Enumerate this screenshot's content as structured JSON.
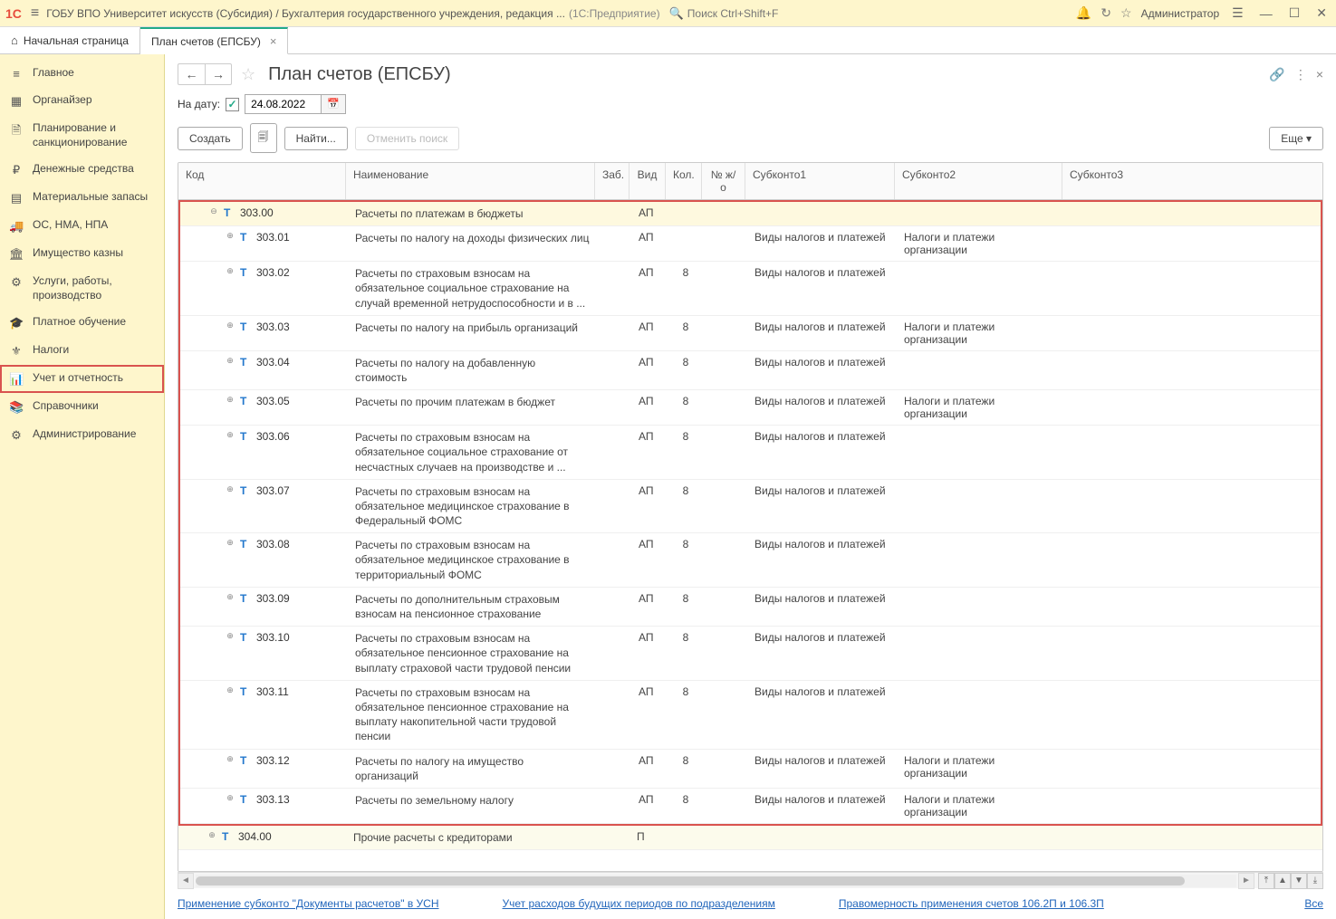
{
  "topbar": {
    "logo_text": "1C",
    "title": "ГОБУ ВПО Университет искусств (Субсидия) / Бухгалтерия государственного учреждения, редакция ...",
    "app_name": "(1С:Предприятие)",
    "search_placeholder": "Поиск Ctrl+Shift+F",
    "user": "Администратор"
  },
  "tabs": {
    "home": "Начальная страница",
    "active": "План счетов (ЕПСБУ)"
  },
  "sidebar": {
    "items": [
      {
        "icon": "≡",
        "label": "Главное"
      },
      {
        "icon": "▦",
        "label": "Органайзер"
      },
      {
        "icon": "🗎",
        "label": "Планирование и санкционирование"
      },
      {
        "icon": "₽",
        "label": "Денежные средства"
      },
      {
        "icon": "▤",
        "label": "Материальные запасы"
      },
      {
        "icon": "🚚",
        "label": "ОС, НМА, НПА"
      },
      {
        "icon": "🏛",
        "label": "Имущество казны"
      },
      {
        "icon": "⚙",
        "label": "Услуги, работы, производство"
      },
      {
        "icon": "🎓",
        "label": "Платное обучение"
      },
      {
        "icon": "⚜",
        "label": "Налоги"
      },
      {
        "icon": "📊",
        "label": "Учет и отчетность"
      },
      {
        "icon": "📚",
        "label": "Справочники"
      },
      {
        "icon": "⚙",
        "label": "Администрирование"
      }
    ],
    "highlighted_index": 10
  },
  "page": {
    "title": "План счетов (ЕПСБУ)",
    "date_label": "На дату:",
    "date_value": "24.08.2022",
    "create_btn": "Создать",
    "find_btn": "Найти...",
    "cancel_search_btn": "Отменить поиск",
    "more_btn": "Еще"
  },
  "table": {
    "headers": {
      "code": "Код",
      "name": "Наименование",
      "zab": "Заб.",
      "vid": "Вид",
      "kol": "Кол.",
      "njo": "№ ж/о",
      "sub1": "Субконто1",
      "sub2": "Субконто2",
      "sub3": "Субконто3"
    },
    "rows": [
      {
        "indent": 1,
        "expand": "⊖",
        "code": "303.00",
        "name": "Расчеты по платежам в бюджеты",
        "vid": "АП",
        "kol": "",
        "sub1": "",
        "sub2": "",
        "selected": true
      },
      {
        "indent": 2,
        "expand": "⊕",
        "code": "303.01",
        "name": "Расчеты по налогу на доходы физических лиц",
        "vid": "АП",
        "kol": "",
        "sub1": "Виды налогов и платежей",
        "sub2": "Налоги и платежи организации"
      },
      {
        "indent": 2,
        "expand": "⊕",
        "code": "303.02",
        "name": "Расчеты по страховым взносам на обязательное социальное страхование на случай временной нетрудоспособности и в ...",
        "vid": "АП",
        "kol": "8",
        "sub1": "Виды налогов и платежей",
        "sub2": ""
      },
      {
        "indent": 2,
        "expand": "⊕",
        "code": "303.03",
        "name": "Расчеты по налогу на прибыль организаций",
        "vid": "АП",
        "kol": "8",
        "sub1": "Виды налогов и платежей",
        "sub2": "Налоги и платежи организации"
      },
      {
        "indent": 2,
        "expand": "⊕",
        "code": "303.04",
        "name": "Расчеты по налогу на добавленную стоимость",
        "vid": "АП",
        "kol": "8",
        "sub1": "Виды налогов и платежей",
        "sub2": ""
      },
      {
        "indent": 2,
        "expand": "⊕",
        "code": "303.05",
        "name": "Расчеты по прочим платежам в бюджет",
        "vid": "АП",
        "kol": "8",
        "sub1": "Виды налогов и платежей",
        "sub2": "Налоги и платежи организации"
      },
      {
        "indent": 2,
        "expand": "⊕",
        "code": "303.06",
        "name": "Расчеты по страховым взносам на обязательное социальное страхование от несчастных случаев на производстве и ...",
        "vid": "АП",
        "kol": "8",
        "sub1": "Виды налогов и платежей",
        "sub2": ""
      },
      {
        "indent": 2,
        "expand": "⊕",
        "code": "303.07",
        "name": "Расчеты по страховым взносам на обязательное медицинское страхование в Федеральный ФОМС",
        "vid": "АП",
        "kol": "8",
        "sub1": "Виды налогов и платежей",
        "sub2": ""
      },
      {
        "indent": 2,
        "expand": "⊕",
        "code": "303.08",
        "name": "Расчеты по страховым взносам на обязательное медицинское страхование в территориальный ФОМС",
        "vid": "АП",
        "kol": "8",
        "sub1": "Виды налогов и платежей",
        "sub2": ""
      },
      {
        "indent": 2,
        "expand": "⊕",
        "code": "303.09",
        "name": "Расчеты по дополнительным страховым взносам на пенсионное страхование",
        "vid": "АП",
        "kol": "8",
        "sub1": "Виды налогов и платежей",
        "sub2": ""
      },
      {
        "indent": 2,
        "expand": "⊕",
        "code": "303.10",
        "name": "Расчеты по страховым взносам на обязательное пенсионное страхование на выплату страховой части трудовой пенсии",
        "vid": "АП",
        "kol": "8",
        "sub1": "Виды налогов и платежей",
        "sub2": ""
      },
      {
        "indent": 2,
        "expand": "⊕",
        "code": "303.11",
        "name": "Расчеты по страховым взносам на обязательное пенсионное страхование на выплату накопительной части трудовой пенсии",
        "vid": "АП",
        "kol": "8",
        "sub1": "Виды налогов и платежей",
        "sub2": ""
      },
      {
        "indent": 2,
        "expand": "⊕",
        "code": "303.12",
        "name": "Расчеты по налогу на имущество организаций",
        "vid": "АП",
        "kol": "8",
        "sub1": "Виды налогов и платежей",
        "sub2": "Налоги и платежи организации"
      },
      {
        "indent": 2,
        "expand": "⊕",
        "code": "303.13",
        "name": "Расчеты по земельному налогу",
        "vid": "АП",
        "kol": "8",
        "sub1": "Виды налогов и платежей",
        "sub2": "Налоги и платежи организации"
      }
    ],
    "row_outside": {
      "indent": 1,
      "expand": "⊕",
      "code": "304.00",
      "name": "Прочие расчеты с кредиторами",
      "vid": "П",
      "kol": "",
      "sub1": "",
      "sub2": ""
    }
  },
  "footer": {
    "link1": "Применение субконто \"Документы расчетов\" в УСН",
    "link2": "Учет расходов будущих периодов по подразделениям",
    "link3": "Правомерность применения счетов 106.2П и 106.3П",
    "all": "Все"
  }
}
